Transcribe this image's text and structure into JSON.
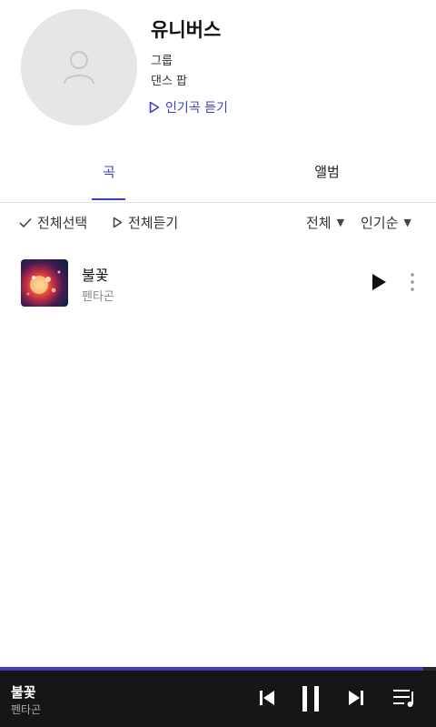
{
  "artist": {
    "name": "유니버스",
    "type": "그룹",
    "genre": "댄스 팝",
    "popular_play_label": "인기곡 듣기"
  },
  "tabs": [
    {
      "label": "곡",
      "active": true
    },
    {
      "label": "앨범",
      "active": false
    }
  ],
  "controls": {
    "select_all": "전체선택",
    "play_all": "전체듣기",
    "filter": "전체",
    "sort": "인기순"
  },
  "tracks": [
    {
      "title": "불꽃",
      "artist": "펜타곤"
    }
  ],
  "now_playing": {
    "title": "불꽃",
    "artist": "펜타곤",
    "progress": 0.97
  },
  "colors": {
    "accent": "#3b3fc4",
    "player_bg": "#161616",
    "avatar_bg": "#e6e6e6"
  },
  "icons": {
    "avatar": "person-placeholder-icon",
    "popular_play": "play-outline-icon",
    "select_all": "check-icon",
    "play_all": "play-outline-icon",
    "dropdown": "caret-down-icon",
    "track_play": "play-icon",
    "track_more": "more-vertical-icon",
    "prev": "skip-previous-icon",
    "pause": "pause-icon",
    "next": "skip-next-icon",
    "queue": "playlist-icon"
  }
}
